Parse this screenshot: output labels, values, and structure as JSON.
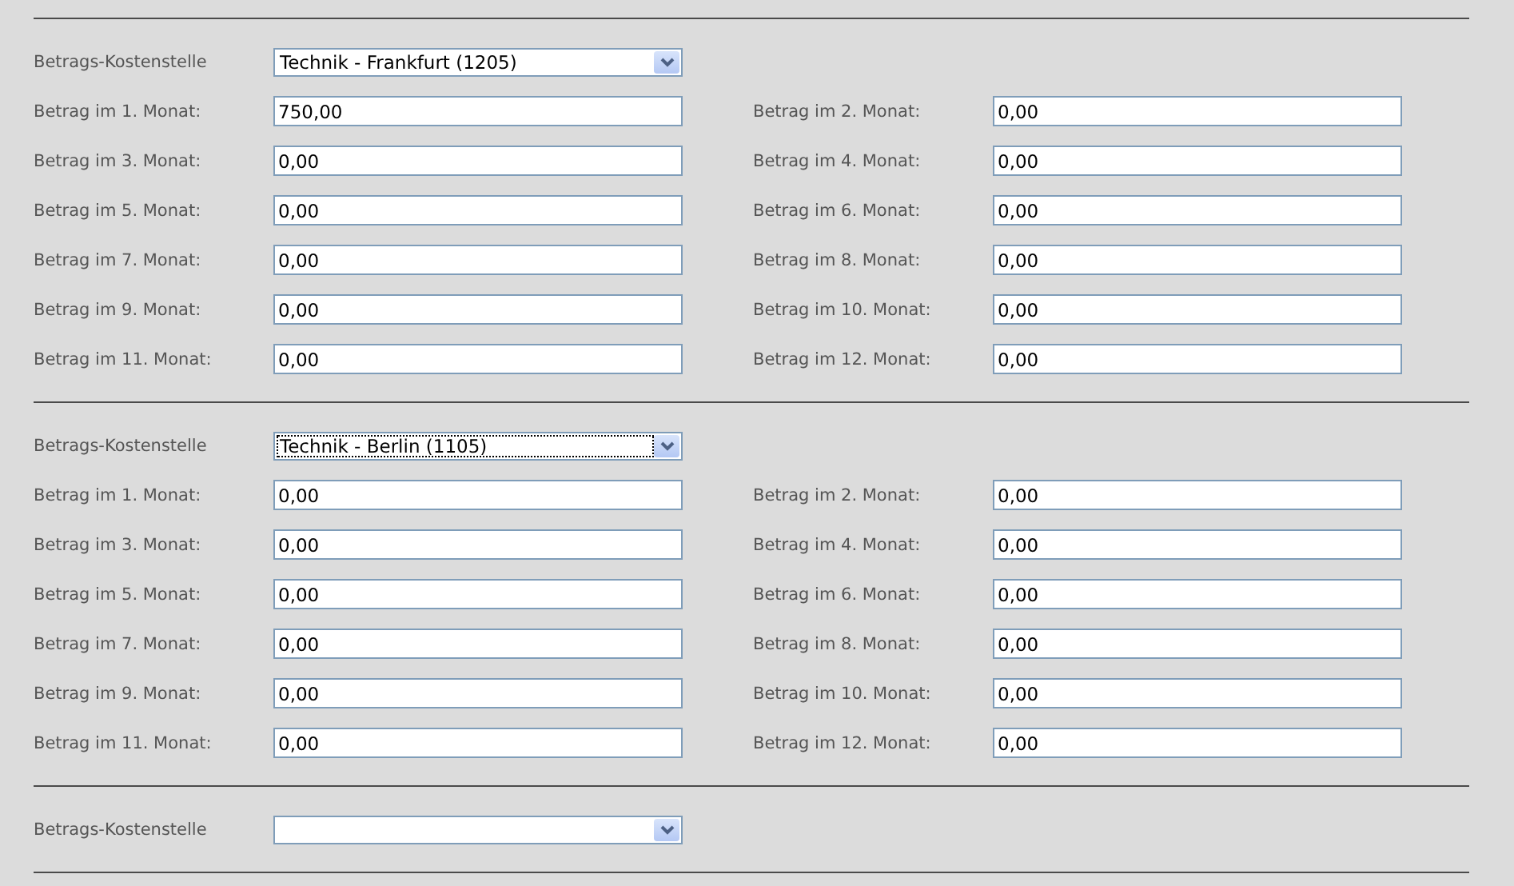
{
  "sections": [
    {
      "cost_center": {
        "label": "Betrags-Kostenstelle",
        "value": "Technik - Frankfurt (1205)",
        "focused": false
      },
      "months": [
        {
          "label": "Betrag im 1. Monat:",
          "value": "750,00"
        },
        {
          "label": "Betrag im 2. Monat:",
          "value": "0,00"
        },
        {
          "label": "Betrag im 3. Monat:",
          "value": "0,00"
        },
        {
          "label": "Betrag im 4. Monat:",
          "value": "0,00"
        },
        {
          "label": "Betrag im 5. Monat:",
          "value": "0,00"
        },
        {
          "label": "Betrag im 6. Monat:",
          "value": "0,00"
        },
        {
          "label": "Betrag im 7. Monat:",
          "value": "0,00"
        },
        {
          "label": "Betrag im 8. Monat:",
          "value": "0,00"
        },
        {
          "label": "Betrag im 9. Monat:",
          "value": "0,00"
        },
        {
          "label": "Betrag im 10. Monat:",
          "value": "0,00"
        },
        {
          "label": "Betrag im 11. Monat:",
          "value": "0,00"
        },
        {
          "label": "Betrag im 12. Monat:",
          "value": "0,00"
        }
      ]
    },
    {
      "cost_center": {
        "label": "Betrags-Kostenstelle",
        "value": "Technik - Berlin (1105)",
        "focused": true
      },
      "months": [
        {
          "label": "Betrag im 1. Monat:",
          "value": "0,00"
        },
        {
          "label": "Betrag im 2. Monat:",
          "value": "0,00"
        },
        {
          "label": "Betrag im 3. Monat:",
          "value": "0,00"
        },
        {
          "label": "Betrag im 4. Monat:",
          "value": "0,00"
        },
        {
          "label": "Betrag im 5. Monat:",
          "value": "0,00"
        },
        {
          "label": "Betrag im 6. Monat:",
          "value": "0,00"
        },
        {
          "label": "Betrag im 7. Monat:",
          "value": "0,00"
        },
        {
          "label": "Betrag im 8. Monat:",
          "value": "0,00"
        },
        {
          "label": "Betrag im 9. Monat:",
          "value": "0,00"
        },
        {
          "label": "Betrag im 10. Monat:",
          "value": "0,00"
        },
        {
          "label": "Betrag im 11. Monat:",
          "value": "0,00"
        },
        {
          "label": "Betrag im 12. Monat:",
          "value": "0,00"
        }
      ]
    },
    {
      "cost_center": {
        "label": "Betrags-Kostenstelle",
        "focused": false
      }
    }
  ]
}
